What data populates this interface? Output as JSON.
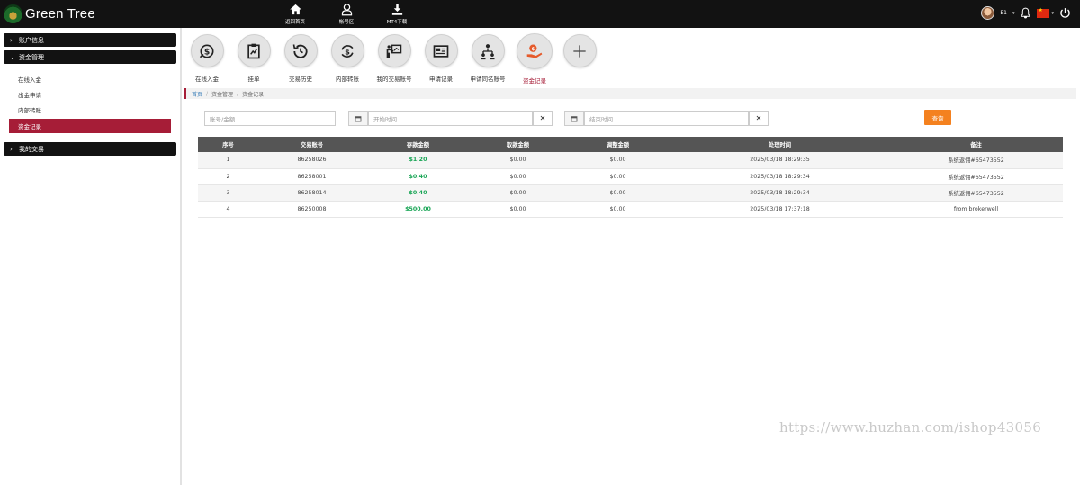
{
  "brand": {
    "name": "Green Tree"
  },
  "topnav": [
    {
      "label": "返回首页",
      "icon": "home-icon"
    },
    {
      "label": "帐号区",
      "icon": "user-icon"
    },
    {
      "label": "MT4下载",
      "icon": "download-icon"
    }
  ],
  "user": {
    "label": "E1",
    "flag": "cn-flag-icon"
  },
  "sidebar": {
    "sections": [
      {
        "label": "账户信息",
        "expanded": false
      },
      {
        "label": "资金管理",
        "expanded": true
      },
      {
        "label": "我的交易",
        "expanded": false
      }
    ],
    "sub_items": [
      {
        "label": "在线入金",
        "active": false
      },
      {
        "label": "出金申请",
        "active": false
      },
      {
        "label": "内部转账",
        "active": false
      },
      {
        "label": "资金记录",
        "active": true
      }
    ]
  },
  "shortcuts": [
    {
      "label": "在线入金",
      "icon": "deposit-icon"
    },
    {
      "label": "挂单",
      "icon": "clipboard-chart-icon"
    },
    {
      "label": "交易历史",
      "icon": "history-icon"
    },
    {
      "label": "内部转账",
      "icon": "transfer-icon"
    },
    {
      "label": "我的交易账号",
      "icon": "presenter-icon"
    },
    {
      "label": "申请记录",
      "icon": "record-icon"
    },
    {
      "label": "申请同名账号",
      "icon": "org-icon"
    },
    {
      "label": "资金记录",
      "icon": "money-hand-icon",
      "active": true
    },
    {
      "label": "",
      "icon": "plus-icon"
    }
  ],
  "breadcrumb": {
    "home": "首页",
    "level1": "资金管理",
    "level2": "资金记录"
  },
  "filters": {
    "account_placeholder": "账号/金额",
    "start_placeholder": "开始时间",
    "end_placeholder": "结束时间",
    "query_label": "查询"
  },
  "table": {
    "headers": [
      "序号",
      "交易账号",
      "存款金额",
      "取款金额",
      "调整金额",
      "处理时间",
      "备注"
    ],
    "rows": [
      [
        "1",
        "86258026",
        "$1.20",
        "$0.00",
        "$0.00",
        "2025/03/18 18:29:35",
        "系统返佣#65473552"
      ],
      [
        "2",
        "86258001",
        "$0.40",
        "$0.00",
        "$0.00",
        "2025/03/18 18:29:34",
        "系统返佣#65473552"
      ],
      [
        "3",
        "86258014",
        "$0.40",
        "$0.00",
        "$0.00",
        "2025/03/18 18:29:34",
        "系统返佣#65473552"
      ],
      [
        "4",
        "86250008",
        "$500.00",
        "$0.00",
        "$0.00",
        "2025/03/18 17:37:18",
        "from brokerwell"
      ]
    ]
  },
  "colors": {
    "accent": "#a61d37",
    "query_button": "#f4811f",
    "deposit_text": "#18a555",
    "topbar": "#121212"
  },
  "watermark": "https://www.huzhan.com/ishop43056"
}
